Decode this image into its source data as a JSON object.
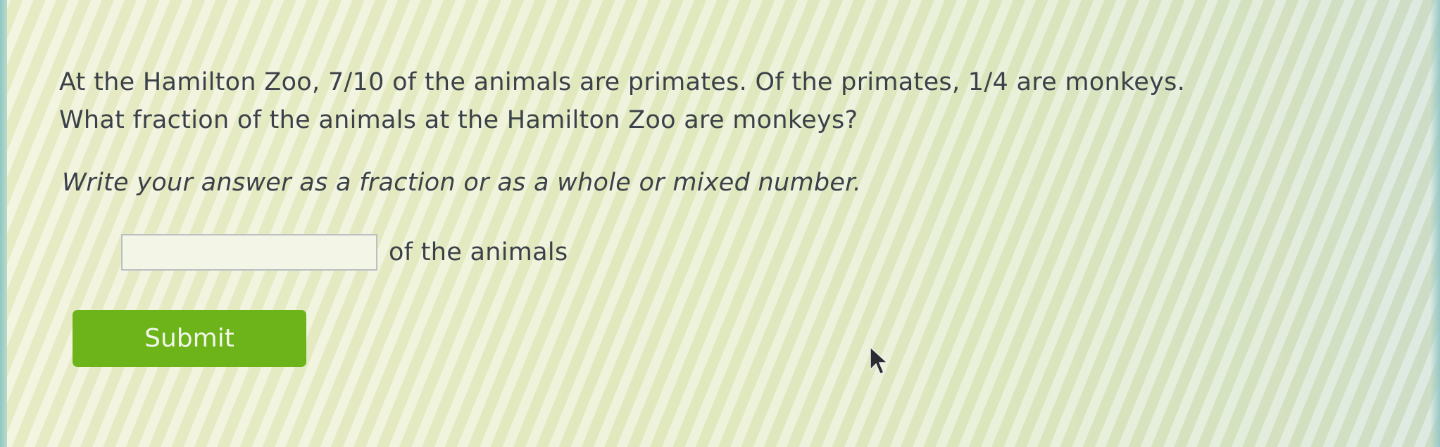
{
  "question": {
    "line1": "At the Hamilton Zoo, 7/10 of the animals are primates. Of the primates, 1/4 are monkeys.",
    "line2": "What fraction of the animals at the Hamilton Zoo are monkeys?"
  },
  "instruction": "Write your answer as a fraction or as a whole or mixed number.",
  "answer": {
    "value": "",
    "suffix": "of the animals"
  },
  "submit_label": "Submit",
  "colors": {
    "submit_button": "#6cb41a",
    "text": "#3b4148"
  },
  "icons": {
    "cursor": "arrow-cursor-icon"
  }
}
